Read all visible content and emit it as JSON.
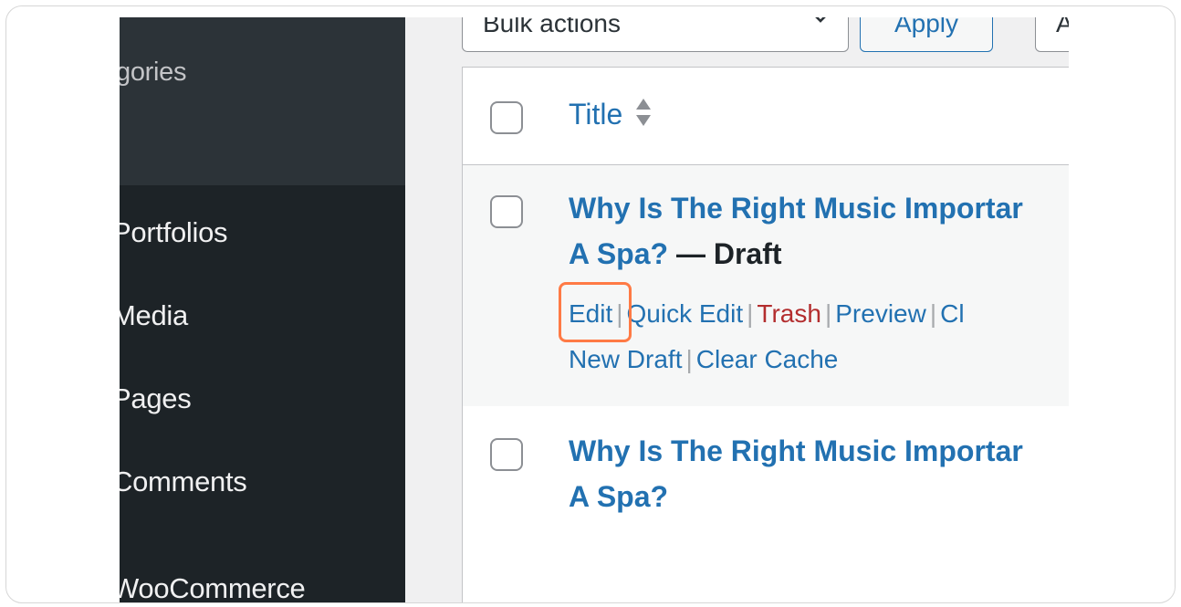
{
  "sidebar": {
    "sub_item": "gories",
    "items": [
      "Portfolios",
      "Media",
      "Pages",
      "Comments",
      "WooCommerce"
    ]
  },
  "toolbar": {
    "bulk_actions": "Bulk actions",
    "apply": "Apply",
    "next_select": "A"
  },
  "table": {
    "header_title": "Title",
    "rows": [
      {
        "title_line1": "Why Is The Right Music Importar",
        "title_line2": "A Spa?",
        "state": " — Draft",
        "actions": [
          "Edit",
          "Quick Edit",
          "Trash",
          "Preview",
          "Cl"
        ],
        "actions_line2": [
          "New Draft",
          "Clear Cache"
        ]
      },
      {
        "title_line1": "Why Is The Right Music Importar",
        "title_line2": "A Spa?"
      }
    ]
  },
  "colors": {
    "sidebar_bg": "#1d2327",
    "link": "#2271b1",
    "trash": "#b32d2e",
    "highlight": "#ff7a45"
  }
}
